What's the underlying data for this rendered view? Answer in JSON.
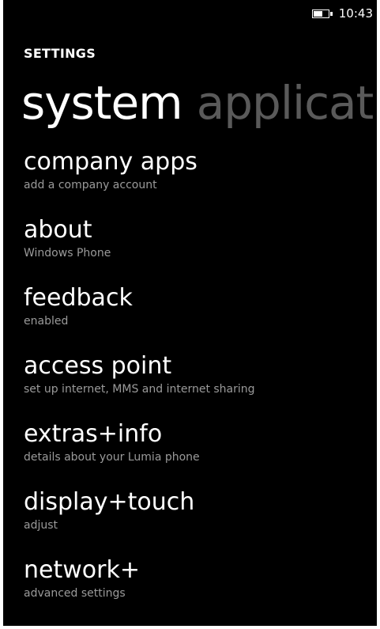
{
  "status_bar": {
    "battery_icon": "battery-icon",
    "time": "10:43"
  },
  "header": {
    "app_title": "SETTINGS",
    "pivot_active": "system",
    "pivot_next": "applicat"
  },
  "items": [
    {
      "title": "company apps",
      "subtitle": "add a company account"
    },
    {
      "title": "about",
      "subtitle": "Windows Phone"
    },
    {
      "title": "feedback",
      "subtitle": "enabled"
    },
    {
      "title": "access point",
      "subtitle": "set up internet, MMS and internet sharing"
    },
    {
      "title": "extras+info",
      "subtitle": "details about your Lumia phone"
    },
    {
      "title": "display+touch",
      "subtitle": "adjust"
    },
    {
      "title": "network+",
      "subtitle": "advanced settings"
    }
  ],
  "colors": {
    "background": "#000000",
    "text": "#ffffff",
    "subtitle": "#9a9a9a",
    "pivot_inactive": "#5a5a5a"
  }
}
